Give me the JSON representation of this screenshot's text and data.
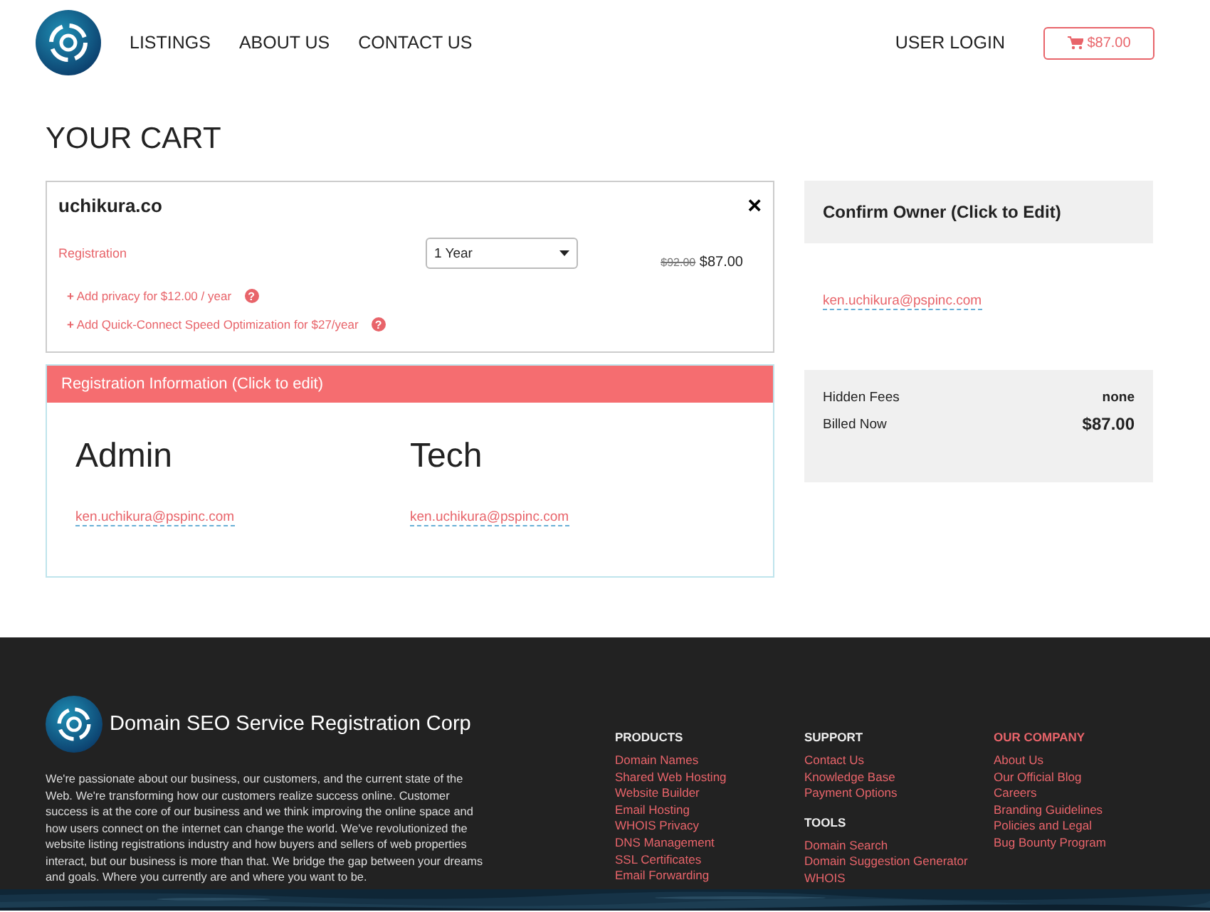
{
  "nav": {
    "links": [
      "LISTINGS",
      "ABOUT US",
      "CONTACT US"
    ],
    "login": "USER LOGIN",
    "cart_total": "$87.00"
  },
  "title": "YOUR CART",
  "cart_item": {
    "domain": "uchikura.co",
    "close": "×",
    "label": "Registration",
    "term": "1 Year",
    "old_price": "$92.00",
    "price": "$87.00",
    "addons": [
      {
        "icon": "+",
        "text": "Add privacy for $12.00 / year",
        "help": "?"
      },
      {
        "icon": "+",
        "text": "Add Quick-Connect Speed Optimization for $27/year",
        "help": "?"
      }
    ]
  },
  "registration": {
    "header": "Registration Information (Click to edit)",
    "contacts": [
      {
        "role": "Admin",
        "email": "ken.uchikura@pspinc.com"
      },
      {
        "role": "Tech",
        "email": "ken.uchikura@pspinc.com"
      }
    ]
  },
  "owner": {
    "header": "Confirm Owner (Click to Edit)",
    "email": "ken.uchikura@pspinc.com"
  },
  "summary": [
    {
      "label": "Hidden Fees",
      "value": "none",
      "kind": "fee"
    },
    {
      "label": "Billed Now",
      "value": "$87.00",
      "kind": "total"
    }
  ],
  "footer": {
    "brand": "Domain SEO Service Registration Corp",
    "about": "We're passionate about our business, our customers, and the current state of the Web. We're transforming how our customers realize success online. Customer success is at the core of our business and we think improving the online space and how users connect on the internet can change the world. We've revolutionized the website listing registrations industry and how buyers and sellers of web properties interact, but our business is more than that. We bridge the gap between your dreams and goals. Where you currently are and where you want to be.",
    "columns": [
      {
        "sections": [
          {
            "heading": "PRODUCTS",
            "kind": "plain",
            "links": [
              "Domain Names",
              "Shared Web Hosting",
              "Website Builder",
              "Email Hosting",
              "WHOIS Privacy",
              "DNS Management",
              "SSL Certificates",
              "Email Forwarding"
            ]
          }
        ]
      },
      {
        "sections": [
          {
            "heading": "SUPPORT",
            "kind": "plain",
            "links": [
              "Contact Us",
              "Knowledge Base",
              "Payment Options"
            ]
          },
          {
            "heading": "TOOLS",
            "kind": "plain",
            "links": [
              "Domain Search",
              "Domain Suggestion Generator",
              "WHOIS"
            ]
          }
        ]
      },
      {
        "sections": [
          {
            "heading": "OUR COMPANY",
            "kind": "accent",
            "links": [
              "About Us",
              "Our Official Blog",
              "Careers",
              "Branding Guidelines",
              "Policies and Legal",
              "Bug Bounty Program"
            ]
          }
        ]
      }
    ]
  }
}
